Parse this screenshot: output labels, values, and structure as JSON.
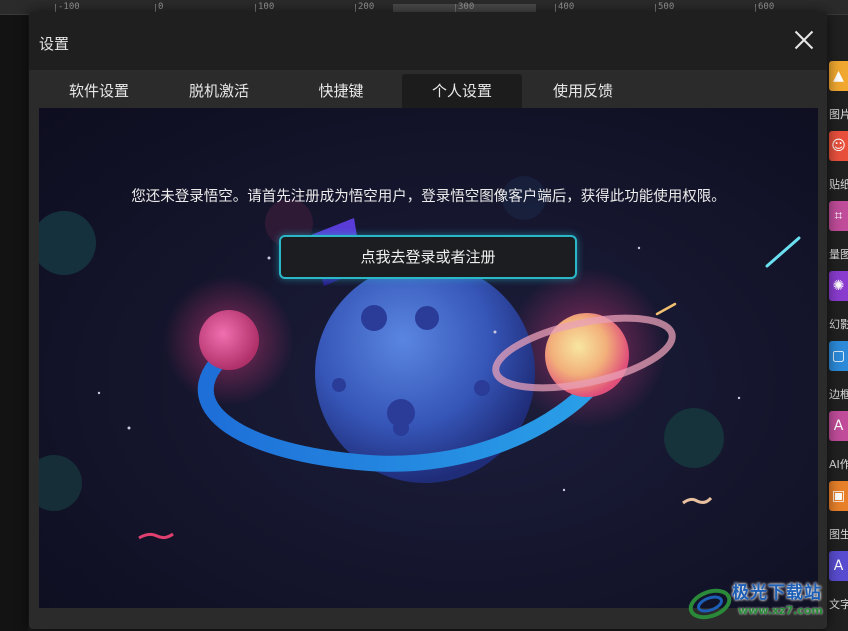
{
  "ruler": {
    "labels": [
      "-100",
      "0",
      "100",
      "200",
      "300",
      "400",
      "500",
      "600"
    ]
  },
  "dialog": {
    "title": "设置",
    "tabs": [
      {
        "label": "软件设置",
        "active": false
      },
      {
        "label": "脱机激活",
        "active": false
      },
      {
        "label": "快捷键",
        "active": false
      },
      {
        "label": "个人设置",
        "active": true
      },
      {
        "label": "使用反馈",
        "active": false
      }
    ],
    "message": "您还未登录悟空。请首先注册成为悟空用户，登录悟空图像客户端后，获得此功能使用权限。",
    "login_button": "点我去登录或者注册"
  },
  "right_panel": {
    "tools": [
      {
        "label": "图片",
        "color": "#f0a830",
        "icon": "image-icon"
      },
      {
        "label": "贴纸",
        "color": "#e8503c",
        "icon": "sticker-icon"
      },
      {
        "label": "量图",
        "color": "#c04c9a",
        "icon": "measure-icon"
      },
      {
        "label": "幻影",
        "color": "#8a3ccf",
        "icon": "effect-icon"
      },
      {
        "label": "边框",
        "color": "#2c8ad8",
        "icon": "frame-icon"
      },
      {
        "label": "AI作",
        "color": "#c04c9a",
        "icon": "ai-icon"
      },
      {
        "label": "图生",
        "color": "#e8802a",
        "icon": "ai-image-icon"
      },
      {
        "label": "文字",
        "color": "#5a4cd0",
        "icon": "text-icon"
      }
    ]
  },
  "watermark": {
    "name": "极光下载站",
    "url": "www.xz7.com"
  }
}
